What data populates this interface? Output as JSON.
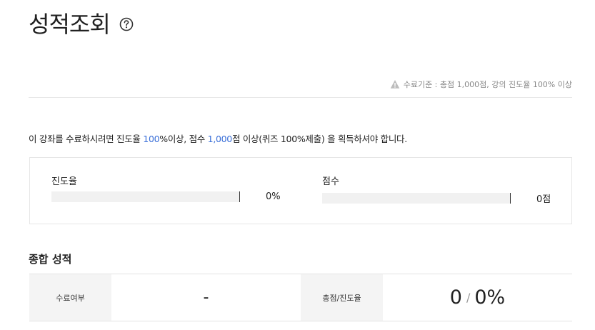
{
  "page": {
    "title": "성적조회",
    "help_icon": "question-circle-icon"
  },
  "criteria": {
    "icon": "warning-triangle-icon",
    "text": "수료기준 : 총점 1,000점, 강의 진도율 100% 이상"
  },
  "notice": {
    "part1": "이 강좌를 수료하시려면 진도율 ",
    "progress_req": "100",
    "part2": "%이상, 점수 ",
    "score_req": "1,000",
    "part3": "점 이상(퀴즈 100%제출) 을 획득하셔야 합니다."
  },
  "progress": {
    "label": "진도율",
    "value": "0%",
    "fraction": 0
  },
  "score": {
    "label": "점수",
    "value": "0점",
    "fraction": 0
  },
  "summary": {
    "section_title": "종합 성적",
    "completion_label": "수료여부",
    "completion_value": "-",
    "total_label": "총점/진도율",
    "total_score": "0",
    "separator": "/",
    "total_progress": "0%"
  },
  "colors": {
    "accent": "#3a6fd8",
    "label_bg": "#f4f4f4",
    "bar_track": "#f1f1f1"
  }
}
